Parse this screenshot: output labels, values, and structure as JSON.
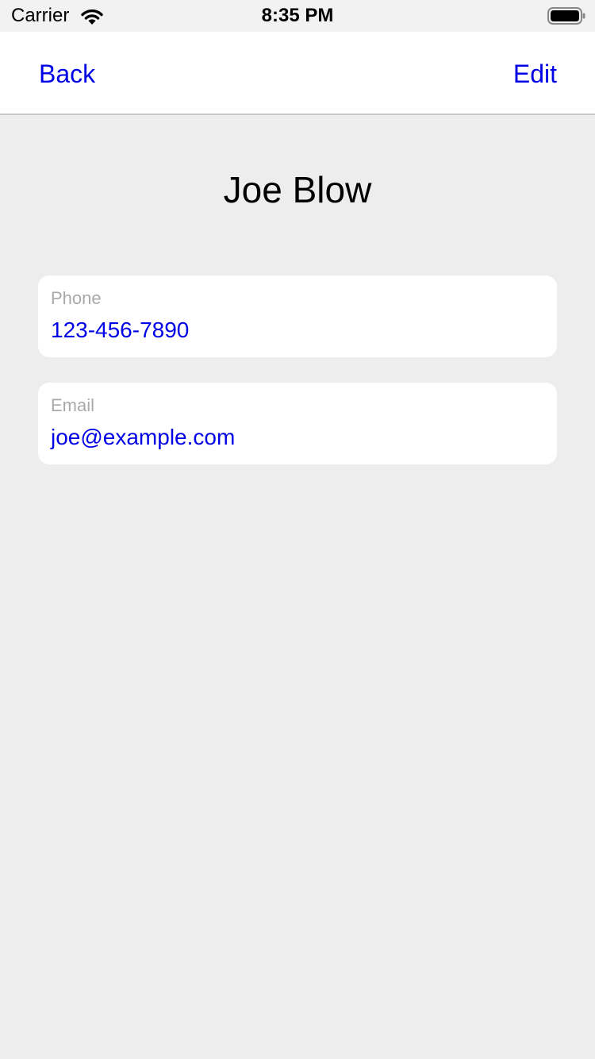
{
  "status_bar": {
    "carrier": "Carrier",
    "time": "8:35 PM",
    "wifi_icon": "wifi-icon",
    "battery_icon": "battery-icon"
  },
  "nav": {
    "back_label": "Back",
    "edit_label": "Edit"
  },
  "contact": {
    "name": "Joe Blow",
    "phone": {
      "label": "Phone",
      "value": "123-456-7890"
    },
    "email": {
      "label": "Email",
      "value": "joe@example.com"
    }
  },
  "colors": {
    "accent": "#0000e6",
    "background": "#ededed",
    "card": "#ffffff",
    "label_gray": "#a9a9a9"
  }
}
